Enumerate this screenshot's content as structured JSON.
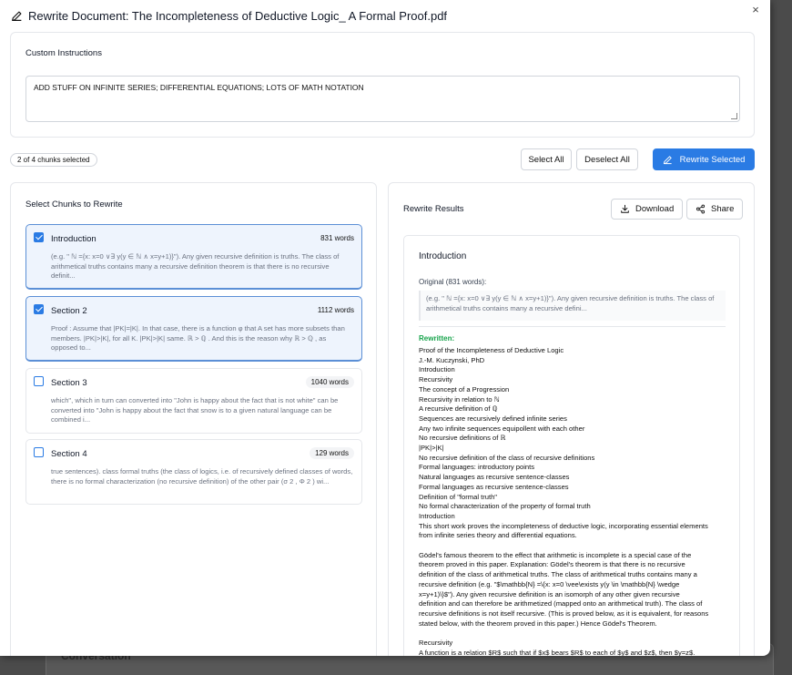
{
  "backdrop": {
    "text": "Conversation"
  },
  "dialog": {
    "title": "Rewrite Document: The Incompleteness of Deductive Logic_ A Formal Proof.pdf",
    "close_label": "×"
  },
  "instructions": {
    "label": "Custom Instructions",
    "value": "ADD STUFF ON INFINITE SERIES; DIFFERENTIAL EQUATIONS; LOTS OF MATH NOTATION"
  },
  "toolbar": {
    "selection_badge": "2 of 4 chunks selected",
    "select_all": "Select All",
    "deselect_all": "Deselect All",
    "rewrite_selected": "Rewrite Selected"
  },
  "chunks_panel": {
    "heading": "Select Chunks to Rewrite",
    "chunks": [
      {
        "name": "Introduction",
        "words": "831 words",
        "selected": true,
        "preview": "(e.g. \" ℕ ={x: x=0 ∨∃ y(y ∈ ℕ ∧ x=y+1)}\"). Any given recursive definition is truths. The class of arithmetical truths contains many a recursive definition theorem is that there is no recursive definit..."
      },
      {
        "name": "Section 2",
        "words": "1112 words",
        "selected": true,
        "preview": "Proof : Assume that |PK|=|K|. In that case, there is a function φ that A set has more subsets than members. |PK|>|K|, for all K. |PK|>|K| same. ℝ > ℚ . And this is the reason why ℝ > ℚ , as opposed to..."
      },
      {
        "name": "Section 3",
        "words": "1040 words",
        "selected": false,
        "preview": "which\", which in turn can converted into \"John is happy about the fact that is not white\" can be converted into \"John is happy about the fact that snow is to a given natural language can be combined i..."
      },
      {
        "name": "Section 4",
        "words": "129 words",
        "selected": false,
        "preview": "true sentences). class formal truths (the class of logics, i.e. of recursively defined classes of words, there is no formal characterization (no recursive definition) of the other pair (σ 2 , Φ 2 ) wi..."
      }
    ]
  },
  "results_panel": {
    "heading": "Rewrite Results",
    "download": "Download",
    "share": "Share",
    "result": {
      "title": "Introduction",
      "original_label": "Original (831 words):",
      "original_preview": "(e.g. \" ℕ ={x: x=0 ∨∃ y(y ∈ ℕ ∧ x=y+1)}\"). Any given recursive definition is truths. The class of arithmetical truths contains many a recursive defini...",
      "rewritten_label": "Rewritten:",
      "rewritten_lines": [
        "Proof of the Incompleteness of Deductive Logic",
        "J.-M. Kuczynski, PhD",
        "Introduction",
        "Recursivity",
        "The concept of a Progression",
        "Recursivity in relation to ℕ",
        "A recursive definition of ℚ",
        "Sequences are recursively defined infinite series",
        "Any two infinite sequences equipollent with each other",
        "No recursive definitions of ℝ",
        "|PK|>|K|",
        "No recursive definition of the class of recursive definitions",
        "Formal languages: introductory points",
        "Natural languages as recursive sentence-classes",
        "Formal languages as recursive sentence-classes",
        "Definition of \"formal truth\"",
        "No formal characterization of the property of formal truth",
        "Introduction",
        "This short work proves the incompleteness of deductive logic, incorporating essential elements",
        "from infinite series theory and differential equations.",
        "",
        "Gödel's famous theorem to the effect that arithmetic is incomplete is a special case of the",
        "theorem proved in this paper. Explanation: Gödel's theorem is that there is no recursive",
        "definition of the class of arithmetical truths. The class of arithmetical truths contains many a",
        "recursive definition (e.g. \"$\\mathbb{N} =\\{x: x=0 \\vee\\exists y(y \\in \\mathbb{N} \\wedge",
        "x=y+1)\\}$\"). Any given recursive definition is an isomorph of any other given recursive",
        "definition and can therefore be arithmetized (mapped onto an arithmetical truth). The class of",
        "recursive definitions is not itself recursive. (This is proved below, as it is equivalent, for reasons",
        "stated below, with the theorem proved in this paper.) Hence Gödel's Theorem.",
        "",
        "Recursivity",
        "A function is a relation $R$ such that if $x$ bears $R$ to each of $y$ and $z$, then $y=z$."
      ]
    }
  },
  "colors": {
    "primary": "#2a7be4",
    "selected_bg": "#eef4fd",
    "rewritten_label": "#16a34a"
  }
}
